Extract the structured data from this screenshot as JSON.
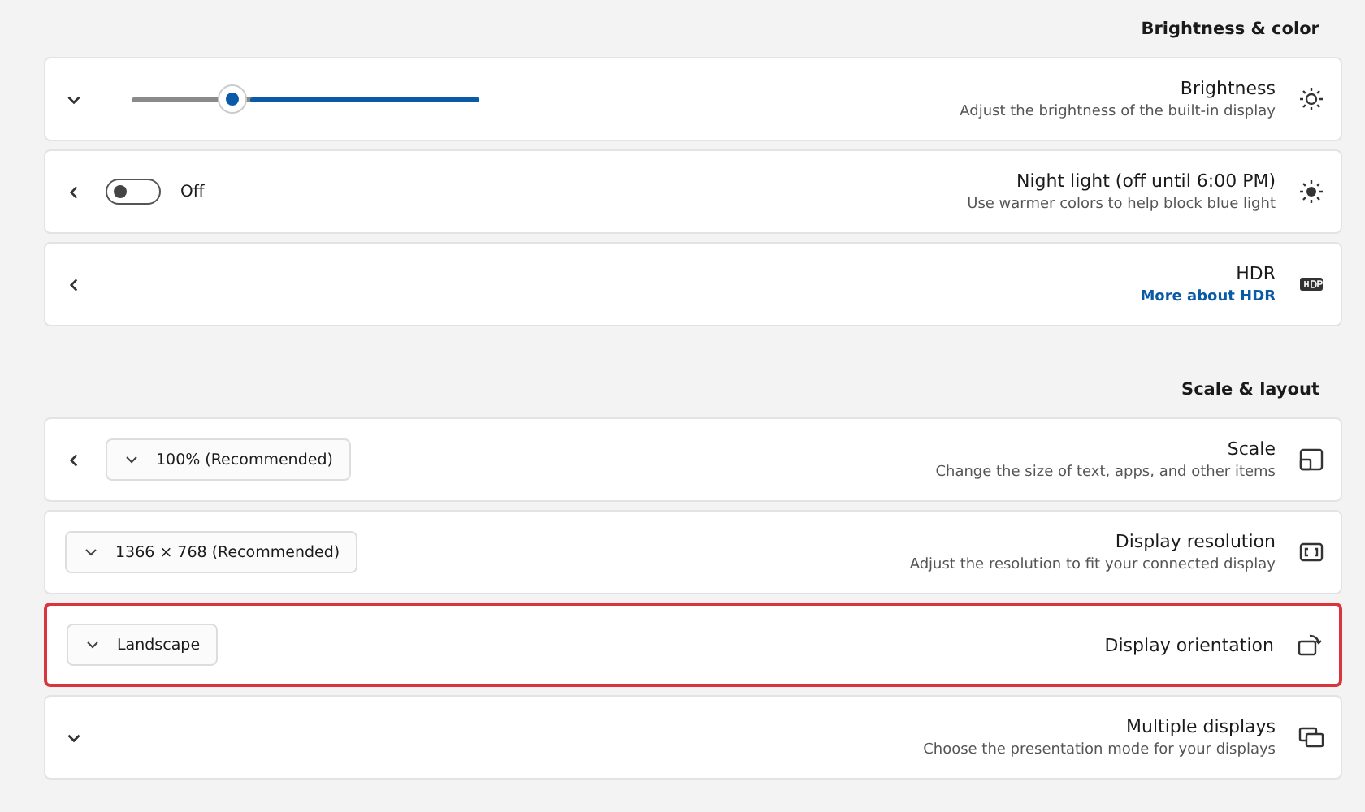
{
  "sections": [
    {
      "heading": "Brightness & color",
      "cards": [
        {
          "kind": "slider",
          "title": "Brightness",
          "subtitle": "Adjust the brightness of the built-in display",
          "level": 0.66,
          "expanded": false,
          "highlighted": false
        },
        {
          "kind": "toggle",
          "title": "Night light (off until 6:00 PM)",
          "subtitle": "Use warmer colors to help block blue light",
          "on": false,
          "state_label": "Off",
          "highlighted": false
        },
        {
          "kind": "link",
          "title": "HDR",
          "link": "More about HDR",
          "highlighted": false
        }
      ]
    },
    {
      "heading": "Scale & layout",
      "cards": [
        {
          "kind": "dropdown",
          "title": "Scale",
          "subtitle": "Change the size of text, apps, and other items",
          "value": "100% (Recommended)",
          "chevron": true,
          "highlighted": false
        },
        {
          "kind": "dropdown",
          "title": "Display resolution",
          "subtitle": "Adjust the resolution to fit your connected display",
          "value": "1366 × 768 (Recommended)",
          "chevron": false,
          "highlighted": false
        },
        {
          "kind": "dropdown",
          "title": "Display orientation",
          "value": "Landscape",
          "chevron": false,
          "highlighted": true
        },
        {
          "kind": "expander",
          "title": "Multiple displays",
          "subtitle": "Choose the presentation mode for your displays",
          "expanded": false,
          "highlighted": false
        }
      ]
    }
  ]
}
